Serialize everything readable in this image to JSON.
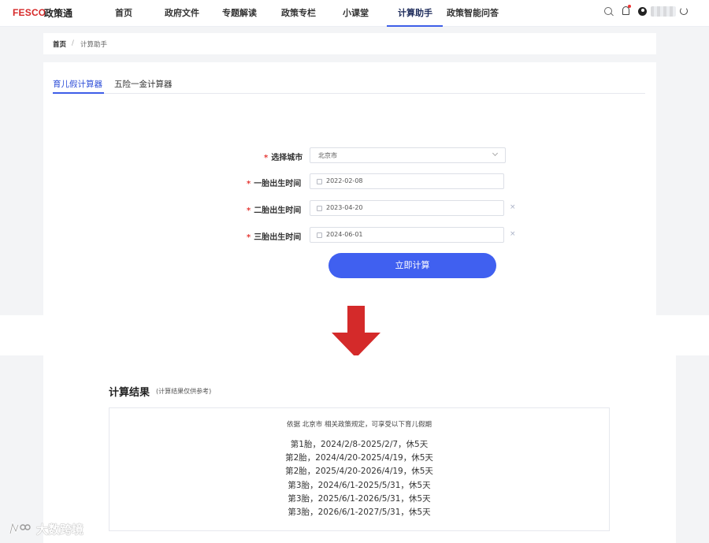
{
  "nav": {
    "logo": "FESCO",
    "product": "政策通",
    "items": [
      "首页",
      "政府文件",
      "专题解读",
      "政策专栏",
      "小课堂",
      "计算助手",
      "政策智能问答"
    ],
    "active": "计算助手"
  },
  "breadcrumb": {
    "home": "首页",
    "separator": "/",
    "current": "计算助手"
  },
  "tabs": [
    {
      "label": "育儿假计算器",
      "active": true
    },
    {
      "label": "五险一金计算器",
      "active": false
    }
  ],
  "form": {
    "required_mark": "*",
    "city": {
      "label": "选择城市",
      "value": "北京市"
    },
    "first_birth": {
      "label": "一胎出生时间",
      "value": "2022-02-08"
    },
    "second_birth": {
      "label": "二胎出生时间",
      "value": "2023-04-20",
      "clear": "×"
    },
    "third_birth": {
      "label": "三胎出生时间",
      "value": "2024-06-01",
      "clear": "×"
    },
    "submit": "立即计算"
  },
  "result": {
    "title": "计算结果",
    "note": "(计算结果仅供参考)",
    "intro": "依据 北京市 相关政策规定，可享受以下育儿假期",
    "lines": [
      "第1胎，2024/2/8-2025/2/7，休5天",
      "第2胎，2024/4/20-2025/4/19，休5天",
      "第2胎，2025/4/20-2026/4/19，休5天",
      "第3胎，2024/6/1-2025/5/31，休5天",
      "第3胎，2025/6/1-2026/5/31，休5天",
      "第3胎，2026/6/1-2027/5/31，休5天"
    ]
  },
  "watermark": "大数跨境",
  "colors": {
    "brand": "#d62828",
    "accent": "#4060f0",
    "arrow": "#d42a2a",
    "required": "#e53935"
  },
  "icons": [
    "search-icon",
    "bell-icon",
    "user-icon",
    "power-icon",
    "calendar-icon",
    "chevron-down-icon",
    "arrow-down-icon"
  ]
}
